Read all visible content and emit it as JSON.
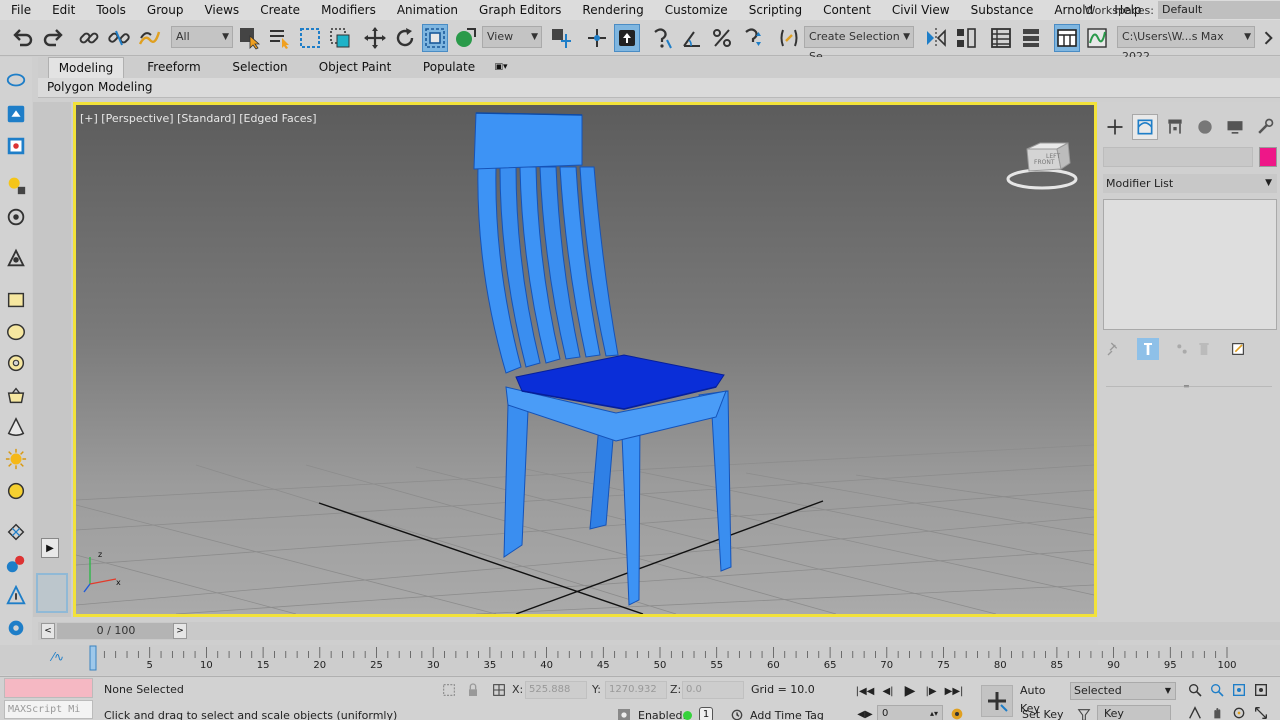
{
  "menu": {
    "items": [
      "File",
      "Edit",
      "Tools",
      "Group",
      "Views",
      "Create",
      "Modifiers",
      "Animation",
      "Graph Editors",
      "Rendering",
      "Customize",
      "Scripting",
      "Content",
      "Civil View",
      "Substance",
      "Arnold",
      "Help"
    ],
    "workspace_label": "Workspaces:",
    "workspace_value": "Default"
  },
  "toolbar": {
    "selection_filter": "All",
    "ref_coord": "View",
    "named_selection_sets": "Create Selection Se",
    "project_path": "C:\\Users\\W...s Max 2022"
  },
  "ribbon": {
    "tabs": [
      "Modeling",
      "Freeform",
      "Selection",
      "Object Paint",
      "Populate"
    ],
    "active_tab": "Modeling",
    "panel_label": "Polygon Modeling"
  },
  "viewport": {
    "label": "[+] [Perspective] [Standard] [Edged Faces]",
    "viewcube_faces": [
      "FRONT",
      "LEFT"
    ],
    "border_color": "#f2e23a",
    "object_color": "#2f86ee"
  },
  "command_panel": {
    "tabs": [
      "create-icon",
      "modify-icon",
      "hierarchy-icon",
      "motion-icon",
      "display-icon",
      "utilities-icon"
    ],
    "active_tab": "modify-icon",
    "modifier_list_label": "Modifier List",
    "object_color_swatch": "#ee1788"
  },
  "time_slider": {
    "frame_display": "0 / 100"
  },
  "track_bar": {
    "tick_labels": [
      "0",
      "5",
      "10",
      "15",
      "20",
      "25",
      "30",
      "35",
      "40",
      "45",
      "50",
      "55",
      "60",
      "65",
      "70",
      "75",
      "80",
      "85",
      "90",
      "95",
      "100"
    ]
  },
  "status": {
    "maxscript_label": "MAXScript Mi",
    "selection_text": "None Selected",
    "prompt_text": "Click and drag to select and scale objects (uniformly)",
    "x_label": "X:",
    "x_value": "525.888",
    "y_label": "Y:",
    "y_value": "1270.932",
    "z_label": "Z:",
    "z_value": "0.0",
    "grid_text": "Grid = 10.0",
    "enabled_label": "Enabled:",
    "enabled_count": "1",
    "add_time_tag": "Add Time Tag",
    "current_frame": "0",
    "auto_key": "Auto Key",
    "set_key": "Set Key",
    "key_mode": "Selected",
    "key_filters": "Key Filters..."
  }
}
